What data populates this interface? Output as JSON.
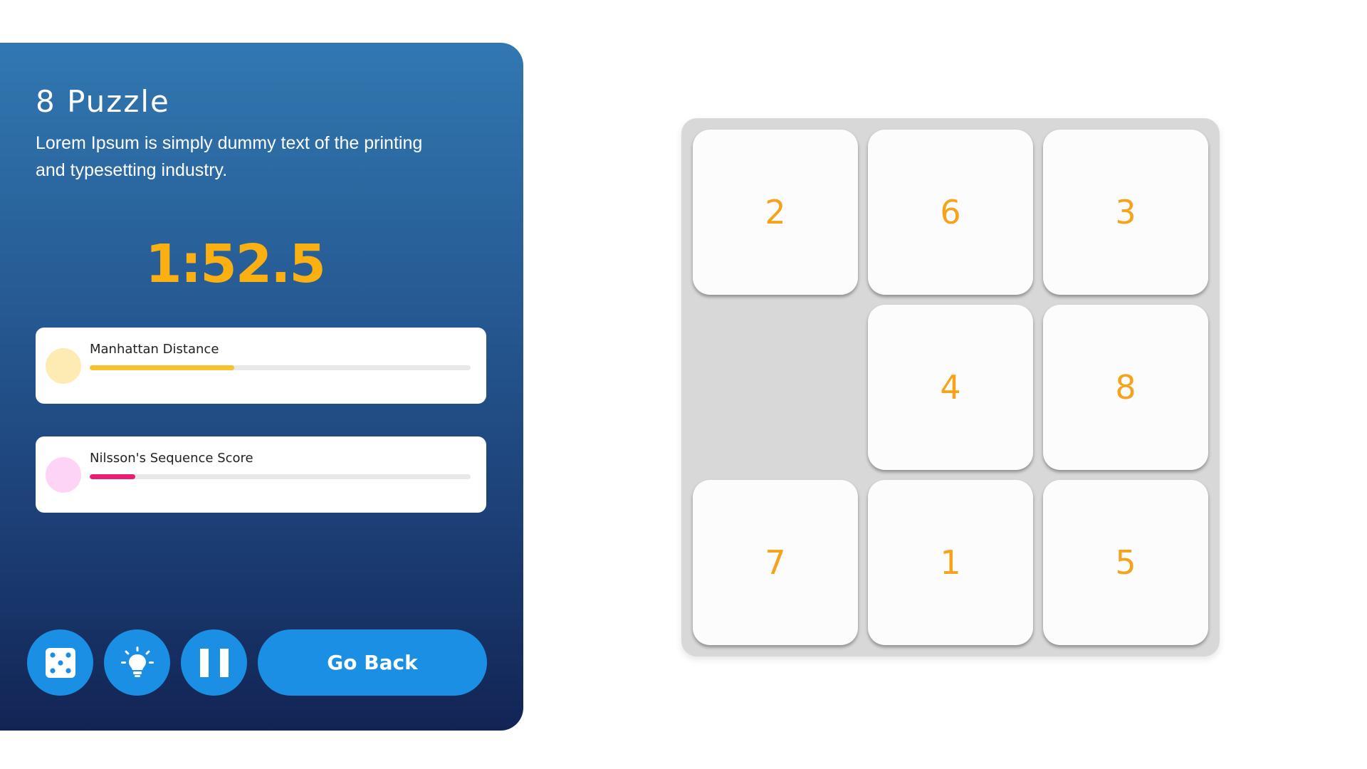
{
  "panel": {
    "title": "8 Puzzle",
    "description": "Lorem Ipsum is simply dummy text of the printing and typesetting industry.",
    "timer": "1:52.5"
  },
  "stats": [
    {
      "label": "Manhattan Distance",
      "progress": 0.38,
      "color": "#fbc02d",
      "dot_color": "#fdebb3"
    },
    {
      "label": "Nilsson's Sequence Score",
      "progress": 0.12,
      "color": "#e91e73",
      "dot_color": "#fdd4f6"
    }
  ],
  "controls": {
    "shuffle_icon": "dice-icon",
    "hint_icon": "lightbulb-icon",
    "pause_icon": "pause-icon",
    "go_back_label": "Go Back"
  },
  "board": {
    "tiles": [
      "2",
      "6",
      "3",
      "",
      "4",
      "8",
      "7",
      "1",
      "5"
    ],
    "tile_color": "#f5a31a"
  }
}
